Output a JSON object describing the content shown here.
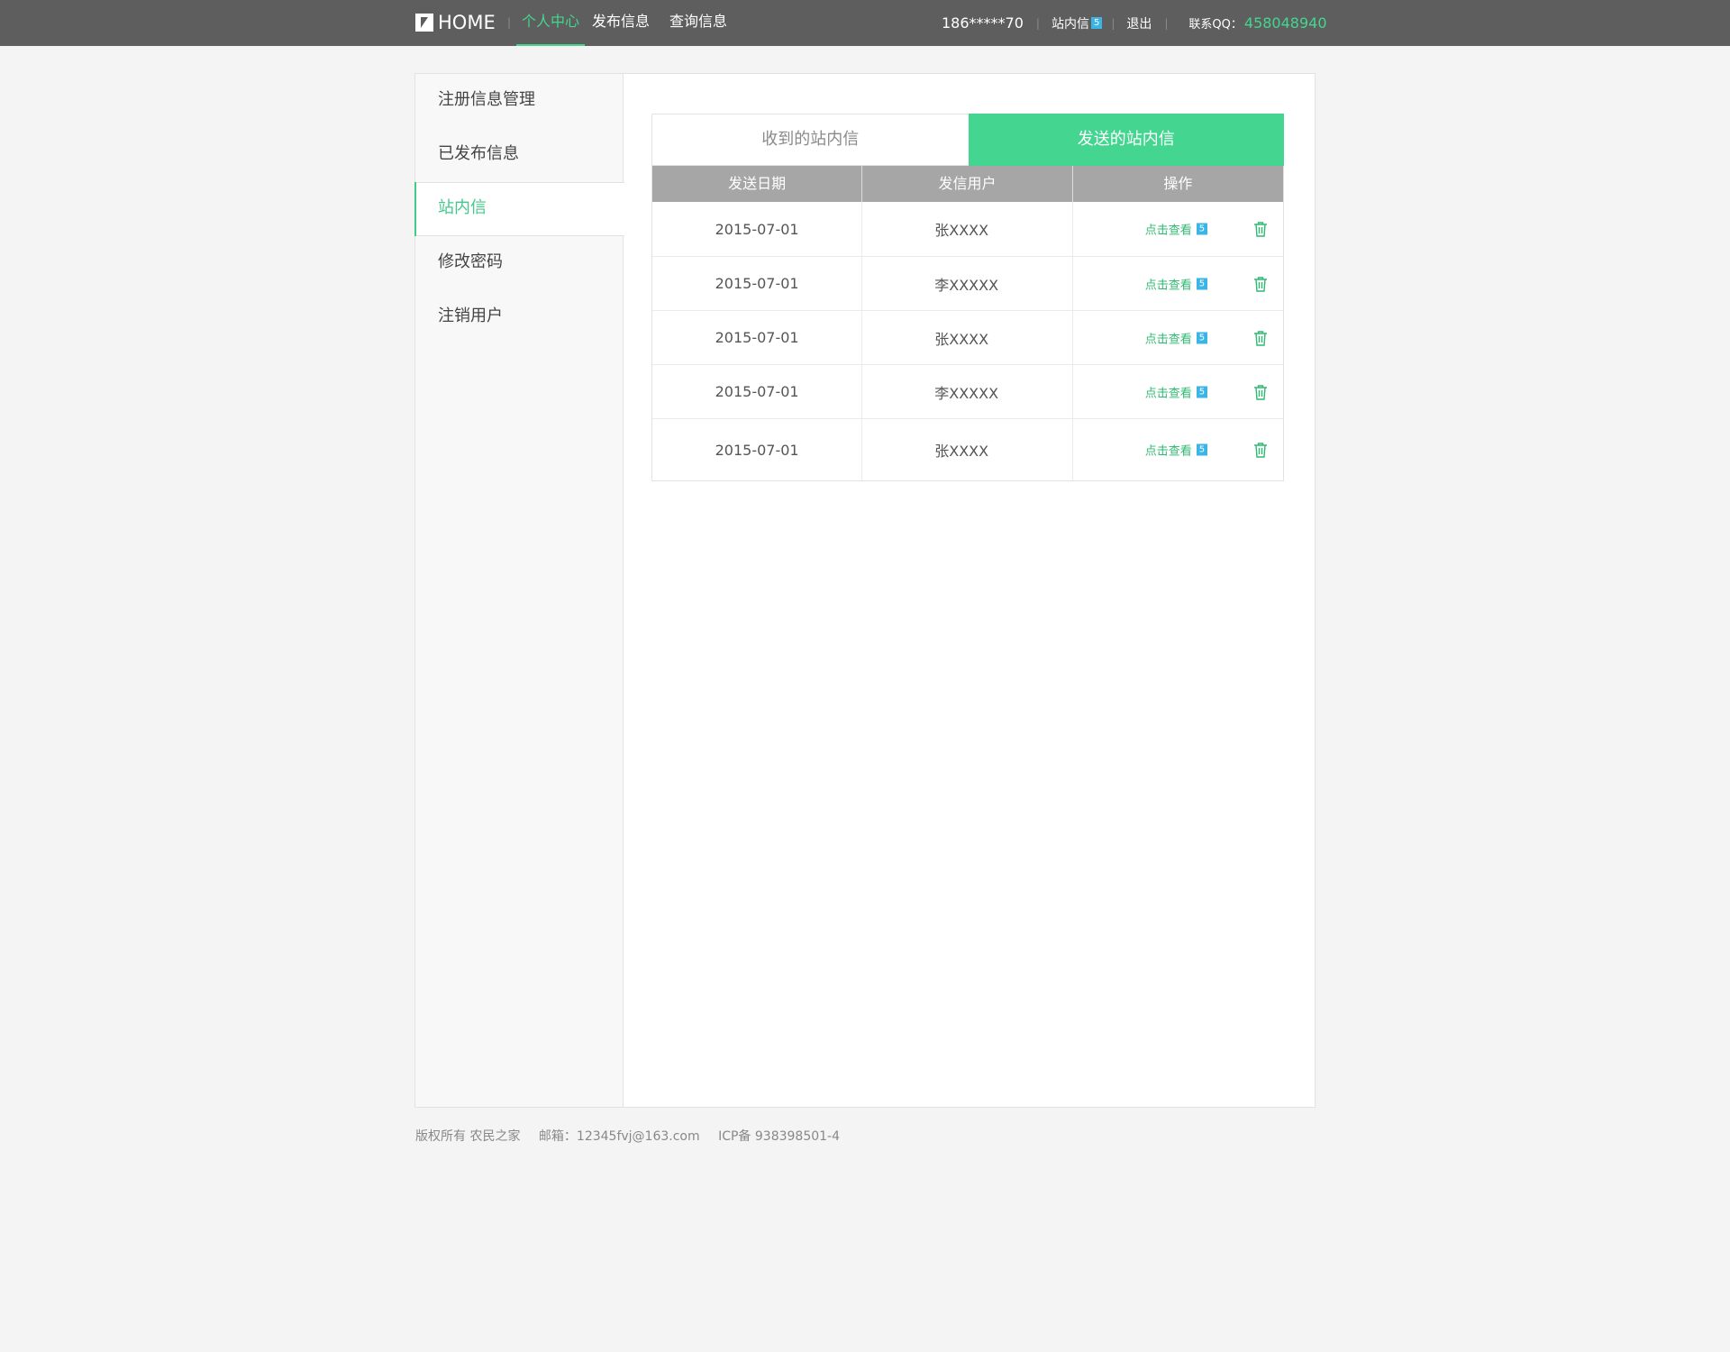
{
  "topbar": {
    "logo_text": "HOME",
    "logo_sep": "|",
    "nav": [
      "个人中心",
      "发布信息",
      "查询信息"
    ],
    "phone": "186*****70",
    "mail_label": "站内信",
    "mail_badge": "5",
    "logout": "退出",
    "qq_label": "联系QQ：",
    "qq_number": "458048940",
    "sep": "|"
  },
  "sidebar": {
    "items": [
      "注册信息管理",
      "已发布信息",
      "站内信",
      "修改密码",
      "注销用户"
    ]
  },
  "tabs": {
    "received": "收到的站内信",
    "sent": "发送的站内信"
  },
  "table": {
    "headers": [
      "发送日期",
      "发信用户",
      "操作"
    ],
    "rows": [
      {
        "date": "2015-07-01",
        "user": "张XXXX",
        "action": "点击查看",
        "badge": "5"
      },
      {
        "date": "2015-07-01",
        "user": "李XXXXX",
        "action": "点击查看",
        "badge": "5"
      },
      {
        "date": "2015-07-01",
        "user": "张XXXX",
        "action": "点击查看",
        "badge": "5"
      },
      {
        "date": "2015-07-01",
        "user": "李XXXXX",
        "action": "点击查看",
        "badge": "5"
      },
      {
        "date": "2015-07-01",
        "user": "张XXXX",
        "action": "点击查看",
        "badge": "5"
      }
    ]
  },
  "footer": {
    "copyright": "版权所有 农民之家",
    "email": "邮箱：12345fvj@163.com",
    "icp": "ICP备 938398501-4"
  },
  "colors": {
    "accent": "#44d690",
    "topbar": "#5e5e5e",
    "badge": "#3bb5e6",
    "header": "#a6a6a6"
  }
}
